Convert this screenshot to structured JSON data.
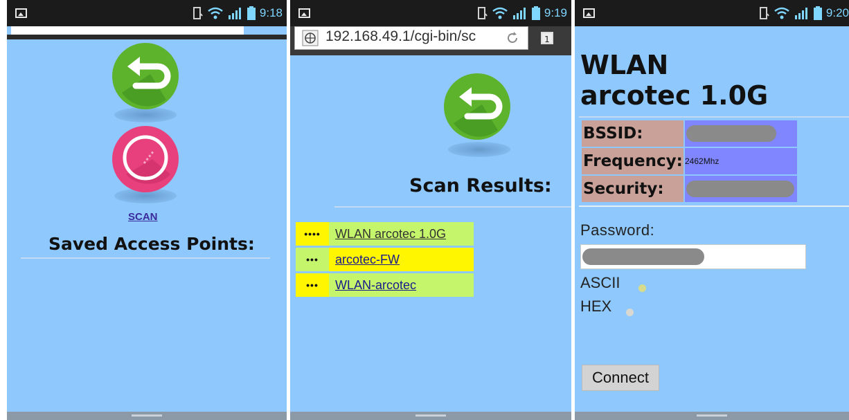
{
  "statusbar": [
    {
      "time": "9:18"
    },
    {
      "time": "9:19"
    },
    {
      "time": "9:20"
    }
  ],
  "screen1": {
    "scan_label": "SCAN",
    "heading": "Saved Access Points:"
  },
  "screen2": {
    "url": "192.168.49.1/cgi-bin/sc",
    "tab_count": "1",
    "heading": "Scan Results:",
    "networks": [
      {
        "strength": "••••",
        "ssid": "WLAN arcotec 1.0G",
        "row_color": "#c4f56a"
      },
      {
        "strength": "•••",
        "ssid": "arcotec-FW",
        "row_color": "#fff600"
      },
      {
        "strength": "•••",
        "ssid": "WLAN-arcotec",
        "row_color": "#c4f56a"
      }
    ]
  },
  "screen3": {
    "title_line1": "WLAN",
    "title_line2": "arcotec 1.0G",
    "bssid_label": "BSSID:",
    "frequency_label": "Frequency:",
    "frequency_value": "2462Mhz",
    "security_label": "Security:",
    "password_label": "Password:",
    "ascii_label": "ASCII",
    "hex_label": "HEX",
    "connect_label": "Connect"
  },
  "colors": {
    "background": "#8ec8fc",
    "statusbar": "#1b1b1b",
    "back_button_green": "#5db32c",
    "scan_button_pink": "#e8407c",
    "label_cell": "#c9a199",
    "value_cell": "#7f86ff"
  },
  "icons": [
    "gallery-icon",
    "phone-vibrate-icon",
    "wifi-icon",
    "signal-icon",
    "battery-icon",
    "back-arrow-icon",
    "scan-radar-icon",
    "globe-icon",
    "refresh-icon"
  ]
}
